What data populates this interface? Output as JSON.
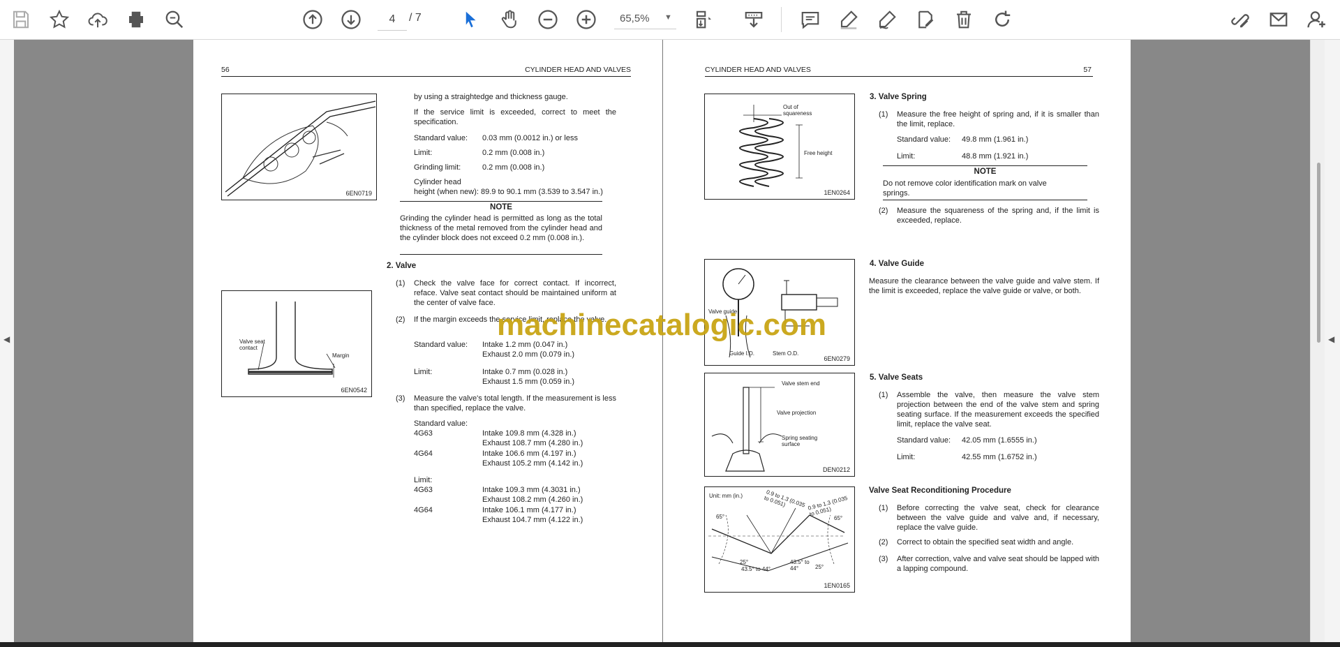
{
  "toolbar": {
    "page_current": "4",
    "page_total": "/ 7",
    "zoom": "65,5%"
  },
  "watermark": "machinecatalogic.com",
  "left_page": {
    "page_number": "56",
    "header": "CYLINDER HEAD AND VALVES",
    "fig1_id": "6EN0719",
    "fig2_id": "6EN0542",
    "fig2_label_seat": "Valve seat contact",
    "fig2_label_margin": "Margin",
    "intro_text": "by using a straightedge and thickness gauge.",
    "exceed_text": "If the service limit is exceeded, correct to meet the specification.",
    "spec1_label": "Standard value:",
    "spec1_value": "0.03 mm (0.0012 in.) or less",
    "spec2_label": "Limit:",
    "spec2_value": "0.2 mm (0.008 in.)",
    "spec3_label": "Grinding limit:",
    "spec3_value": "0.2 mm (0.008 in.)",
    "spec4_label": "Cylinder head",
    "spec4_value": "height (when new): 89.9 to 90.1 mm (3.539 to 3.547 in.)",
    "note_title": "NOTE",
    "note_text": "Grinding the cylinder head is permitted as long as the total thickness of the metal removed from the cylinder head and the cylinder block does not exceed 0.2 mm (0.008 in.).",
    "sec2_title": "2.  Valve",
    "item1_num": "(1)",
    "item1_text": "Check the valve face for correct contact.  If incorrect, reface. Valve seat contact should be maintained uniform at the center of valve face.",
    "item2_num": "(2)",
    "item2_text": "If the margin exceeds the service limit, replace the valve.",
    "item2_std_label": "Standard value:",
    "item2_std_v1": "Intake 1.2 mm (0.047 in.)",
    "item2_std_v2": "Exhaust 2.0 mm (0.079 in.)",
    "item2_lim_label": "Limit:",
    "item2_lim_v1": "Intake 0.7 mm (0.028 in.)",
    "item2_lim_v2": "Exhaust 1.5 mm (0.059 in.)",
    "item3_num": "(3)",
    "item3_text": "Measure the valve's total length.  If the measurement is less than specified, replace the valve.",
    "item3_std_label": "Standard value:",
    "m1": "4G63",
    "m1_v1": "Intake 109.8 mm (4.328 in.)",
    "m1_v2": "Exhaust 108.7 mm (4.280 in.)",
    "m2": "4G64",
    "m2_v1": "Intake 106.6 mm (4.197 in.)",
    "m2_v2": "Exhaust 105.2 mm (4.142 in.)",
    "item3_lim_label": "Limit:",
    "m3": "4G63",
    "m3_v1": "Intake 109.3 mm (4.3031 in.)",
    "m3_v2": "Exhaust 108.2 mm (4.260 in.)",
    "m4": "4G64",
    "m4_v1": "Intake 106.1 mm (4.177 in.)",
    "m4_v2": "Exhaust 104.7 mm (4.122 in.)"
  },
  "right_page": {
    "page_number": "57",
    "header": "CYLINDER HEAD AND VALVES",
    "fig1_id": "1EN0264",
    "fig1_label_a": "Out of squareness",
    "fig1_label_b": "Free height",
    "fig2_id": "6EN0279",
    "fig2_label_a": "Valve guide",
    "fig2_label_b": "Guide I.D.",
    "fig2_label_c": "Stem O.D.",
    "fig3_id": "DEN0212",
    "fig3_label_a": "Valve stem end",
    "fig3_label_b": "Valve projection",
    "fig3_label_c": "Spring seating surface",
    "fig4_id": "1EN0165",
    "fig4_label_unit": "Unit: mm (in.)",
    "fig4_a1": "65°",
    "fig4_a2": "25°",
    "fig4_a3": "43.5° to 44°",
    "fig4_a4": "43.5° to 44°",
    "fig4_a5": "25°",
    "fig4_a6": "65°",
    "fig4_w1": "0.9 to 1.3 (0.035 to 0.051)",
    "fig4_w2": "0.9 to 1.3 (0.035 to 0.051)",
    "sec3_title": "3.  Valve Spring",
    "s3_i1_num": "(1)",
    "s3_i1_text": "Measure the free height of spring and, if it is smaller than the limit, replace.",
    "s3_std_label": "Standard value:",
    "s3_std_value": "49.8 mm (1.961 in.)",
    "s3_lim_label": "Limit:",
    "s3_lim_value": "48.8 mm (1.921 in.)",
    "note_title": "NOTE",
    "note_text": "Do not remove color identification mark on valve springs.",
    "s3_i2_num": "(2)",
    "s3_i2_text": "Measure the squareness of the spring and, if the limit is exceeded, replace.",
    "sec4_title": "4.  Valve Guide",
    "s4_text": "Measure the clearance between the valve guide and valve stem. If the limit is exceeded, replace the valve guide or valve, or both.",
    "sec5_title": "5.  Valve Seats",
    "s5_i1_num": "(1)",
    "s5_i1_text": "Assemble the valve, then measure the valve stem projection between the end of the valve stem and spring seating surface. If the measurement exceeds the specified limit, replace the valve seat.",
    "s5_std_label": "Standard value:",
    "s5_std_value": "42.05 mm (1.6555 in.)",
    "s5_lim_label": "Limit:",
    "s5_lim_value": "42.55 mm (1.6752 in.)",
    "proc_title": "Valve Seat Reconditioning Procedure",
    "p1_num": "(1)",
    "p1_text": "Before correcting the valve seat, check for clearance between the valve guide and valve and, if necessary, replace the valve guide.",
    "p2_num": "(2)",
    "p2_text": "Correct to obtain the specified seat width and angle.",
    "p3_num": "(3)",
    "p3_text": "After correction, valve and valve seat should be lapped with a lapping compound."
  },
  "colors": {
    "icon_gray": "#555555",
    "icon_blue": "#1a6fd8",
    "watermark": "#c9a515",
    "viewer_bg": "#888888"
  }
}
